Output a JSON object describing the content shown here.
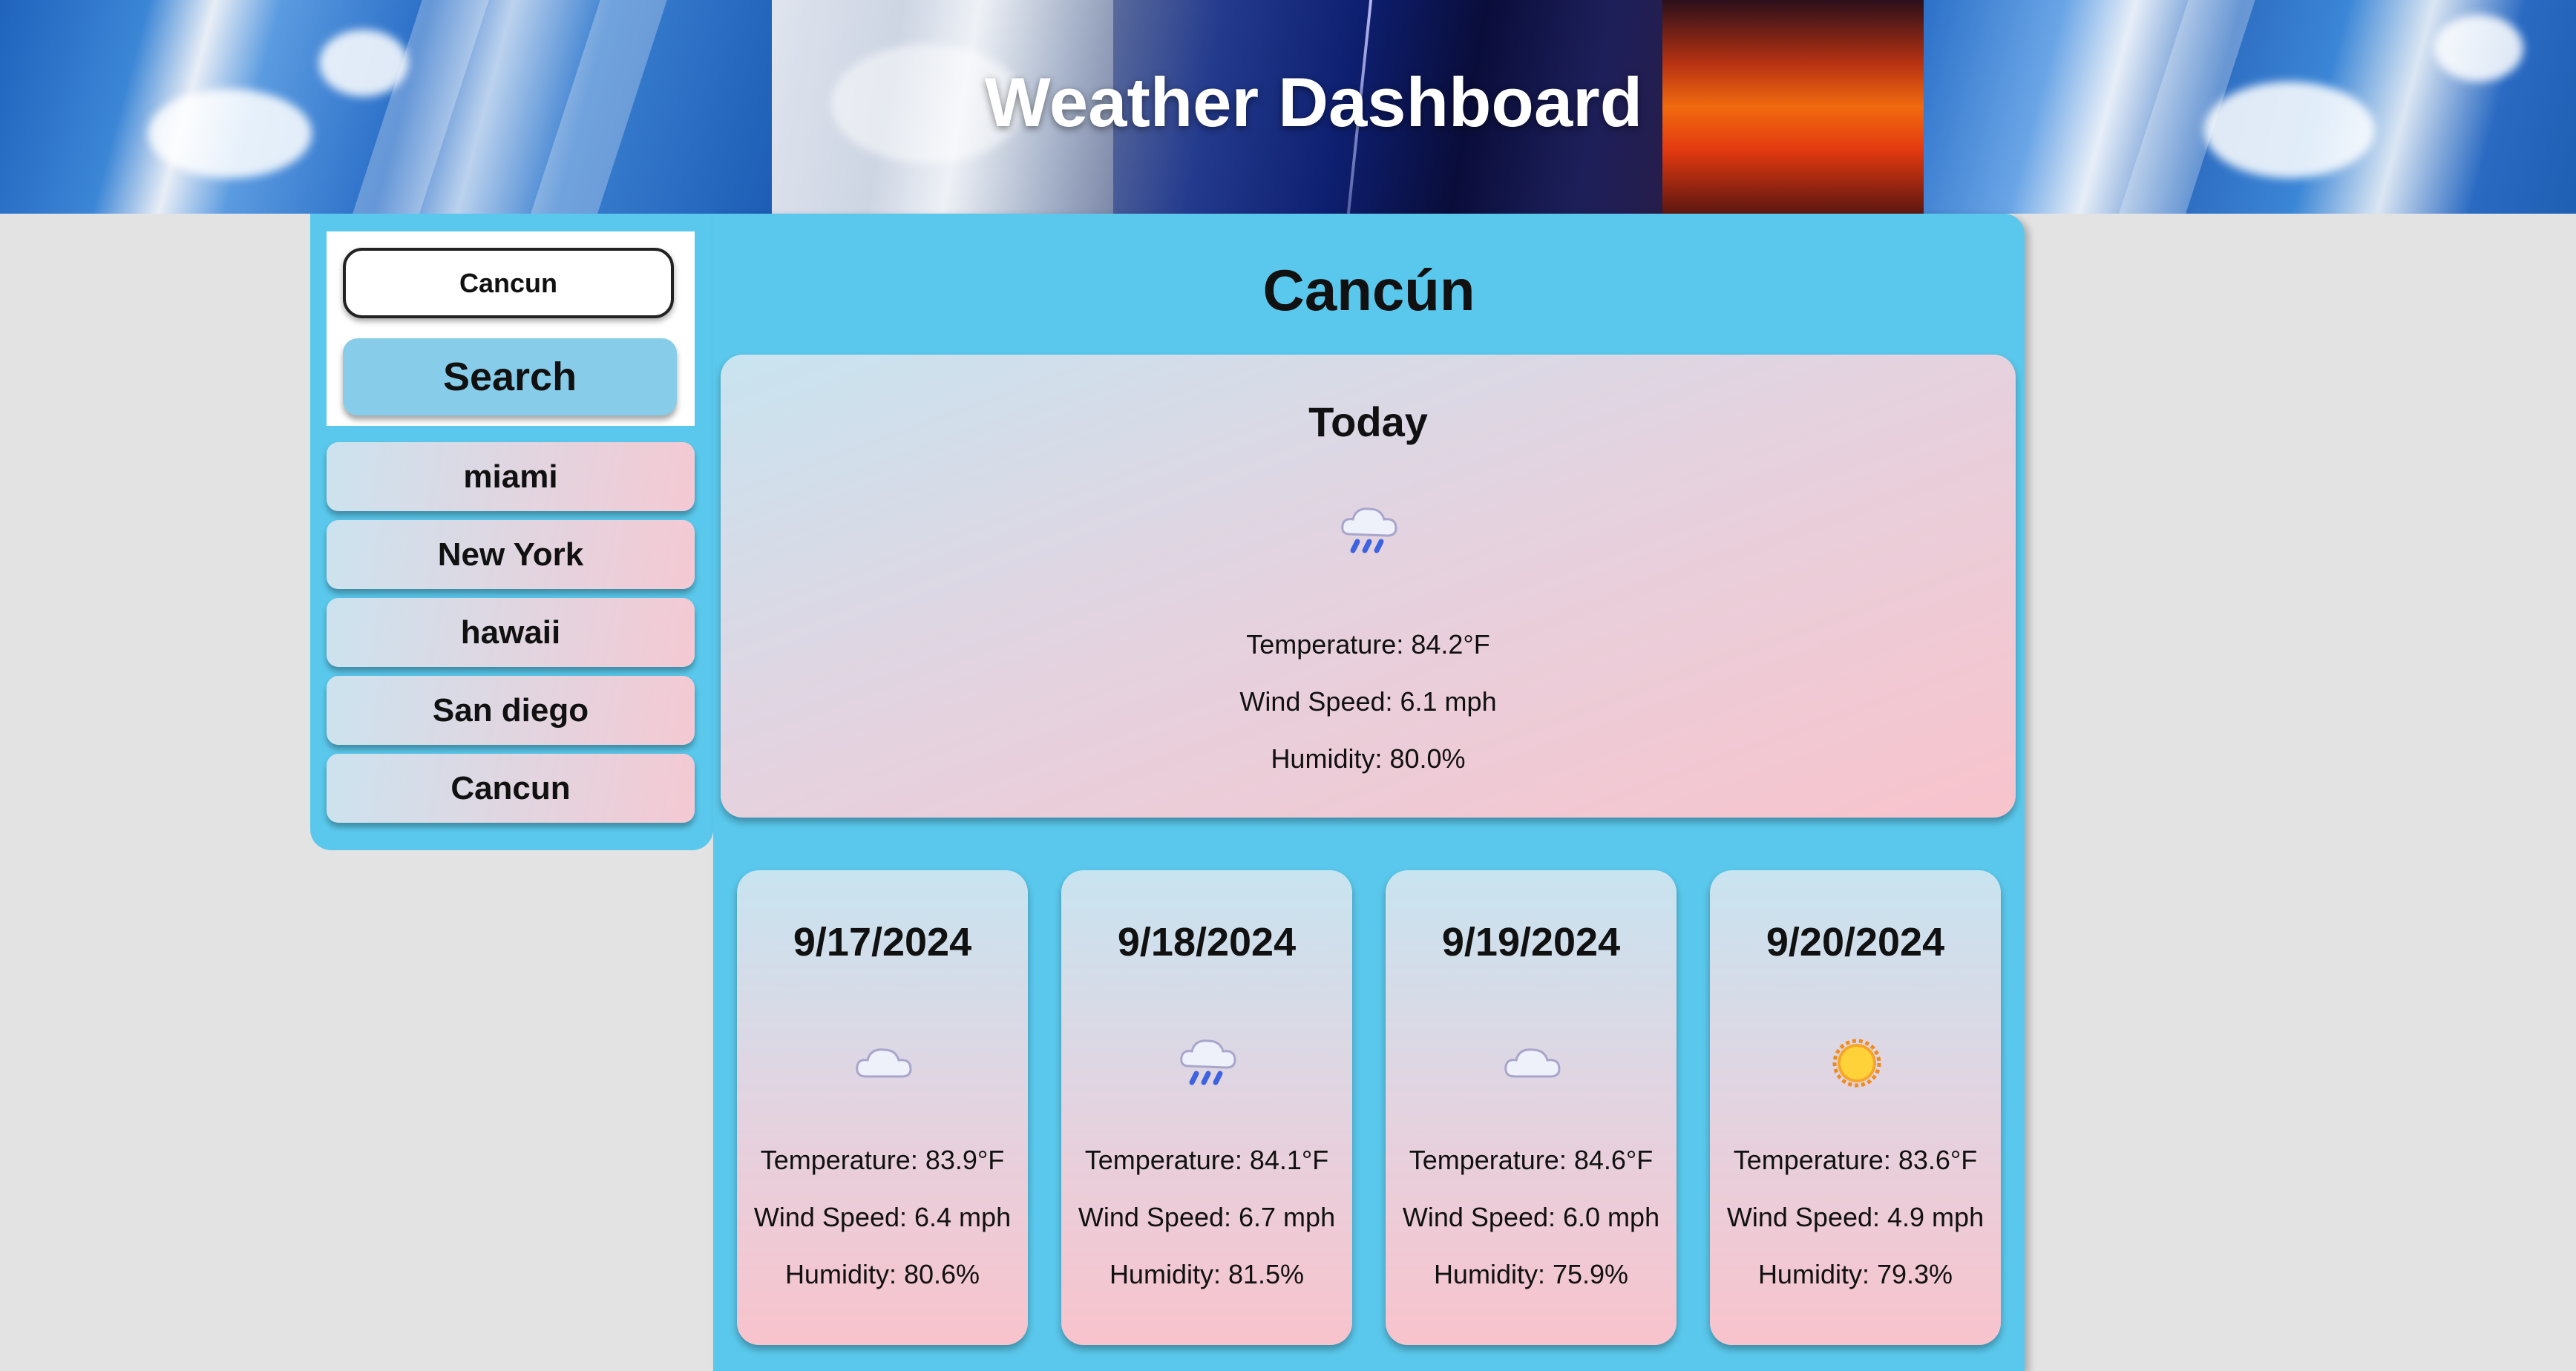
{
  "header": {
    "title": "Weather Dashboard"
  },
  "search": {
    "value": "Cancun",
    "button_label": "Search"
  },
  "history": [
    "miami",
    "New York",
    "hawaii",
    "San diego",
    "Cancun"
  ],
  "current": {
    "city": "Cancún",
    "label": "Today",
    "icon": "rain-cloud-icon",
    "temperature": "Temperature: 84.2°F",
    "wind": "Wind Speed: 6.1 mph",
    "humidity": "Humidity: 80.0%"
  },
  "forecast": [
    {
      "date": "9/17/2024",
      "icon": "cloud-icon",
      "temperature": "Temperature: 83.9°F",
      "wind": "Wind Speed: 6.4 mph",
      "humidity": "Humidity: 80.6%"
    },
    {
      "date": "9/18/2024",
      "icon": "rain-cloud-icon",
      "temperature": "Temperature: 84.1°F",
      "wind": "Wind Speed: 6.7 mph",
      "humidity": "Humidity: 81.5%"
    },
    {
      "date": "9/19/2024",
      "icon": "cloud-icon",
      "temperature": "Temperature: 84.6°F",
      "wind": "Wind Speed: 6.0 mph",
      "humidity": "Humidity: 75.9%"
    },
    {
      "date": "9/20/2024",
      "icon": "sun-icon",
      "temperature": "Temperature: 83.6°F",
      "wind": "Wind Speed: 4.9 mph",
      "humidity": "Humidity: 79.3%"
    }
  ],
  "colors": {
    "panel": "#5ac8ec",
    "button": "#87cdea",
    "card_from": "#c8e4f0",
    "card_to": "#f8c3cc",
    "page_bg": "#e3e3e3"
  }
}
